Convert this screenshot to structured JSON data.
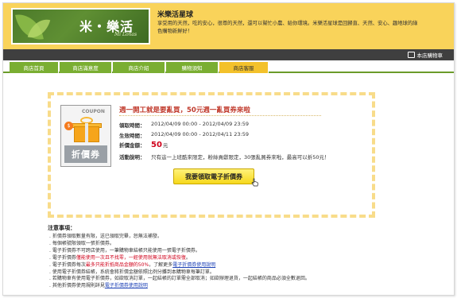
{
  "header": {
    "logo_text": "米‧樂活",
    "logo_sub": "Mi Lohas",
    "site_title": "米樂活星球",
    "site_desc": "享受用的天然，吃的安心，很尊的天然，還可以幫忙小農、給你環境。米樂活星球是回歸直、天然、安心、趣地球的綠色購物新鮮好！"
  },
  "util_bar": {
    "cart_label": "本店購物車"
  },
  "nav": {
    "tabs": [
      {
        "label": "商店首頁"
      },
      {
        "label": "商店滿意度"
      },
      {
        "label": "商店介紹"
      },
      {
        "label": "購物須知"
      },
      {
        "label": "商店客服"
      }
    ]
  },
  "coupon": {
    "image_label": "COUPON",
    "image_banner": "折價券",
    "image_tag": "$",
    "title": "週一開工就是要亂買，50元週一亂買券來啦",
    "claim_period_label": "領取時間：",
    "claim_period_value": "2012/04/09 00:00 - 2012/04/09 23:59",
    "valid_period_label": "生效時間：",
    "valid_period_value": "2012/04/09 00:00 - 2012/04/11 23:59",
    "amount_label": "折價金額：",
    "amount_value": "50",
    "amount_unit": "元",
    "desc_label": "活動說明：",
    "desc_value": "只有這一上班酷來限定，粉絲貢獻限定，30張亂買券來啦，最高可以折50元！",
    "claim_button": "我要領取電子折價券"
  },
  "notes": {
    "title": "注意事項：",
    "items": [
      {
        "pre": ". 折價券領取數量有限，送已領取完畢，恕無法補發。",
        "red": "",
        "post": "",
        "link": ""
      },
      {
        "pre": ". 每個帳號限領取一張折價券。",
        "red": "",
        "post": "",
        "link": ""
      },
      {
        "pre": ". 電子折價券不可跨店使用，一筆購物車結帳只能使用一張電子折價券。",
        "red": "",
        "post": "",
        "link": ""
      },
      {
        "pre": ". 電子折價券",
        "red": "僅能使用一次且不找零，一經使用就無法取消或恢復",
        "post": "。",
        "link": ""
      },
      {
        "pre": ". 電子折價券每次",
        "red": "最多只能折抵商品金額的50%",
        "post": "，了解更多",
        "link": "電子折價券使用說明"
      },
      {
        "pre": ". 使用電子折價券結帳，系統會將折價金額依照比例分攤到本購物車每筆訂單。",
        "red": "",
        "post": "",
        "link": ""
      },
      {
        "pre": ". 若購物車有使用電子折價券，如欲取消訂單，一起結帳的訂單需全部取消；如欲辦理退貨，一起結帳的商品必須全數退回。",
        "red": "",
        "post": "",
        "link": ""
      },
      {
        "pre": ". 其他折價券使用規則詳見",
        "red": "",
        "post": "",
        "link": "電子折價券使用說明"
      }
    ]
  }
}
